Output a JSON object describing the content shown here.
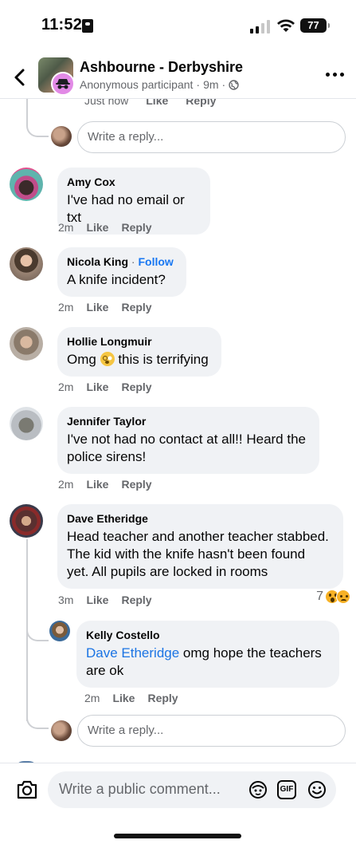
{
  "status_bar": {
    "time": "11:52",
    "battery": "77"
  },
  "header": {
    "title": "Ashbourne - Derbyshire",
    "subtitle_author": "Anonymous participant",
    "subtitle_sep": "·",
    "subtitle_time": "9m",
    "subtitle_sep2": "·"
  },
  "top_cut": {
    "time": "Just now",
    "like": "Like",
    "reply": "Reply"
  },
  "reply_placeholder": "Write a reply...",
  "comments": [
    {
      "author": "Amy Cox",
      "follow": "",
      "text": "I've had no email or txt",
      "time": "2m",
      "like": "Like",
      "reply": "Reply"
    },
    {
      "author": "Nicola King",
      "follow": "Follow",
      "follow_sep": "·",
      "text": "A knife incident?",
      "time": "2m",
      "like": "Like",
      "reply": "Reply"
    },
    {
      "author": "Hollie Longmuir",
      "text_before": "Omg",
      "text_after": "this is terrifying",
      "emoji": "flushed-face",
      "time": "2m",
      "like": "Like",
      "reply": "Reply"
    },
    {
      "author": "Jennifer Taylor",
      "text_line1": "I've not had no contact at all!! Heard the",
      "text_line2": "police sirens!",
      "time": "2m",
      "like": "Like",
      "reply": "Reply"
    },
    {
      "author": "Dave Etheridge",
      "text_line1": "Head teacher and another teacher stabbed.",
      "text_line2": "The kid with the knife hasn't been found",
      "text_line3": "yet. All pupils are locked in rooms",
      "time": "3m",
      "like": "Like",
      "reply": "Reply",
      "reaction_count": "7",
      "reactions": [
        "wow",
        "sad"
      ]
    }
  ],
  "nested_reply": {
    "author": "Kelly Costello",
    "mention": "Dave Etheridge",
    "text_line1": " omg hope the teachers",
    "text_line2": "are ok",
    "time": "2m",
    "like": "Like",
    "reply": "Reply"
  },
  "bottom_bar": {
    "placeholder": "Write a public comment...",
    "gif_label": "GIF"
  },
  "colors": {
    "accent": "#1877f2",
    "bubble": "#f0f2f5",
    "secondary_text": "#65676b"
  }
}
